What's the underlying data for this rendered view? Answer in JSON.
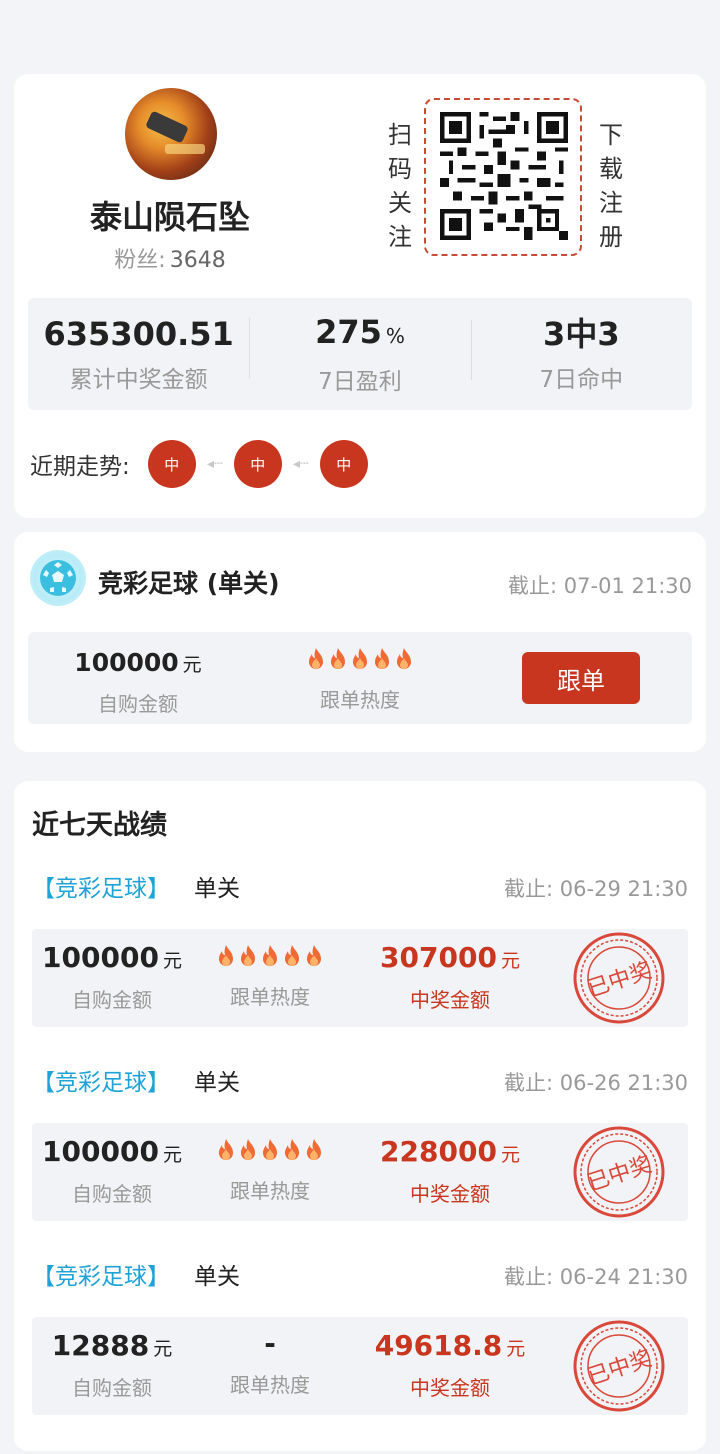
{
  "profile": {
    "nickname": "泰山陨石坠",
    "fans_label": "粉丝:",
    "fans_count": "3648",
    "qr_left_text": [
      "扫",
      "码",
      "关",
      "注"
    ],
    "qr_right_text": [
      "下",
      "载",
      "注",
      "册"
    ],
    "stats": [
      {
        "value": "635300.51",
        "unit": "",
        "label": "累计中奖金额"
      },
      {
        "value": "275",
        "unit": "%",
        "label": "7日盈利"
      },
      {
        "value": "3中3",
        "unit": "",
        "label": "7日命中"
      }
    ],
    "trend_label": "近期走势:",
    "trend": [
      "中",
      "中",
      "中"
    ]
  },
  "plan": {
    "title": "竞彩足球 (单关)",
    "deadline": "截止: 07-01 21:30",
    "amount": "100000",
    "amount_unit": "元",
    "amount_label": "自购金额",
    "heat_level": 5,
    "heat_label": "跟单热度",
    "follow_button": "跟单"
  },
  "records": {
    "title": "近七天战绩",
    "items": [
      {
        "type": "【竞彩足球】",
        "pass": "单关",
        "deadline": "截止: 06-29 21:30",
        "amount": "100000",
        "amount_unit": "元",
        "amount_label": "自购金额",
        "heat_level": 5,
        "heat_text": "",
        "heat_label": "跟单热度",
        "win": "307000",
        "win_unit": "元",
        "win_label": "中奖金额",
        "stamp": "已中奖"
      },
      {
        "type": "【竞彩足球】",
        "pass": "单关",
        "deadline": "截止: 06-26 21:30",
        "amount": "100000",
        "amount_unit": "元",
        "amount_label": "自购金额",
        "heat_level": 5,
        "heat_text": "",
        "heat_label": "跟单热度",
        "win": "228000",
        "win_unit": "元",
        "win_label": "中奖金额",
        "stamp": "已中奖"
      },
      {
        "type": "【竞彩足球】",
        "pass": "单关",
        "deadline": "截止: 06-24 21:30",
        "amount": "12888",
        "amount_unit": "元",
        "amount_label": "自购金额",
        "heat_level": 0,
        "heat_text": "-",
        "heat_label": "跟单热度",
        "win": "49618.8",
        "win_unit": "元",
        "win_label": "中奖金额",
        "stamp": "已中奖"
      }
    ]
  },
  "colors": {
    "accent": "#c9361f",
    "link": "#1fa3d6",
    "muted": "#999999"
  }
}
